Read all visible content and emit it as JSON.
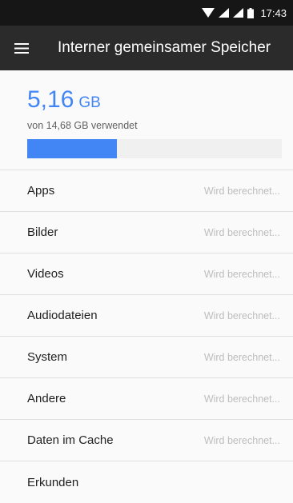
{
  "status_bar": {
    "time": "17:43",
    "icons": [
      "wifi-icon",
      "signal-icon",
      "signal-icon",
      "battery-icon"
    ]
  },
  "toolbar": {
    "menu_icon": "menu-icon",
    "title": "Interner gemeinsamer Speicher"
  },
  "summary": {
    "used_value": "5,16",
    "used_unit": "GB",
    "subtitle": "von 14,68 GB verwendet",
    "used_fraction": 0.351,
    "accent_color": "#4285f4"
  },
  "items": [
    {
      "label": "Apps",
      "status": "Wird berechnet..."
    },
    {
      "label": "Bilder",
      "status": "Wird berechnet..."
    },
    {
      "label": "Videos",
      "status": "Wird berechnet..."
    },
    {
      "label": "Audiodateien",
      "status": "Wird berechnet..."
    },
    {
      "label": "System",
      "status": "Wird berechnet..."
    },
    {
      "label": "Andere",
      "status": "Wird berechnet..."
    },
    {
      "label": "Daten im Cache",
      "status": "Wird berechnet..."
    },
    {
      "label": "Erkunden",
      "status": ""
    }
  ]
}
